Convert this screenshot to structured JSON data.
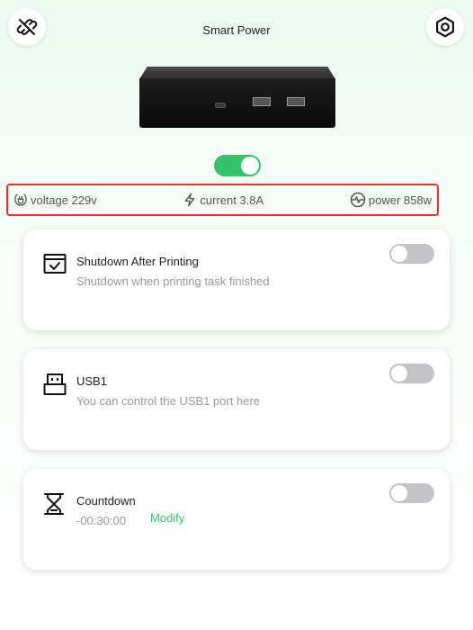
{
  "header": {
    "title": "Smart Power",
    "left_icon": "unlink-icon",
    "right_icon": "settings-gear-icon"
  },
  "device": {
    "main_power_on": true
  },
  "stats": {
    "voltage": "voltage 229v",
    "current": "current 3.8A",
    "power": "power 858w"
  },
  "cards": [
    {
      "title": "Shutdown After Printing",
      "subtitle": "Shutdown when printing task finished",
      "icon": "printer-check-icon",
      "enabled": false
    },
    {
      "title": "USB1",
      "subtitle": "You can control the USB1 port here",
      "icon": "usb-port-icon",
      "enabled": false
    },
    {
      "title": "Countdown",
      "subtitle": "-00:30:00",
      "action": "Modify",
      "icon": "hourglass-icon",
      "enabled": false
    }
  ],
  "colors": {
    "accent": "#34c36a",
    "toggle_off": "#c3c3c8",
    "highlight_border": "#e8332a"
  }
}
